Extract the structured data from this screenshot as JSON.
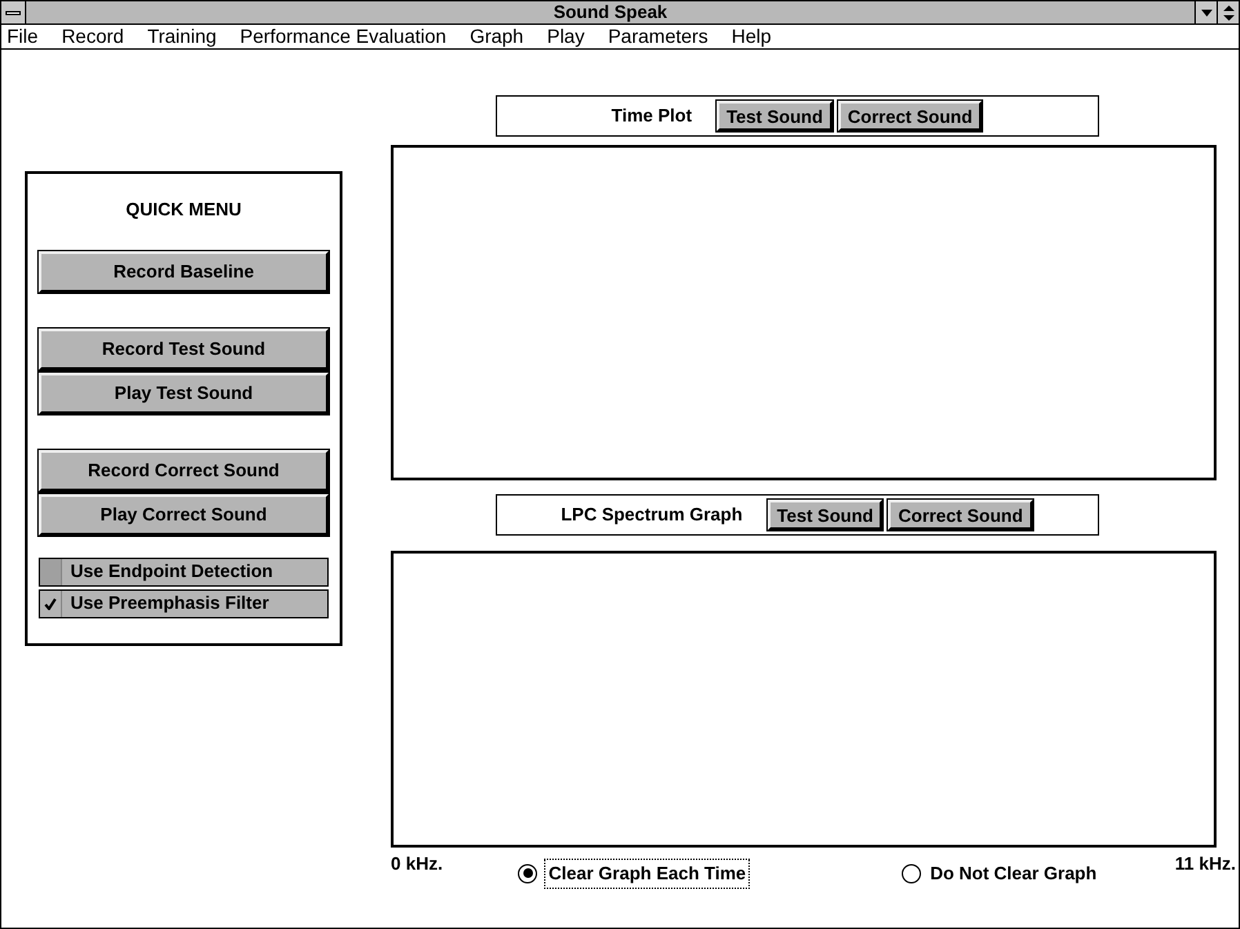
{
  "window": {
    "title": "Sound Speak"
  },
  "menu": [
    {
      "label": "File"
    },
    {
      "label": "Record"
    },
    {
      "label": "Training"
    },
    {
      "label": "Performance Evaluation"
    },
    {
      "label": "Graph"
    },
    {
      "label": "Play"
    },
    {
      "label": "Parameters"
    },
    {
      "label": "Help"
    }
  ],
  "quick_menu": {
    "title": "QUICK MENU",
    "groups": [
      [
        {
          "kind": "button",
          "label": "Record Baseline"
        }
      ],
      [
        {
          "kind": "button",
          "label": "Record Test Sound"
        },
        {
          "kind": "button",
          "label": "Play Test Sound"
        }
      ],
      [
        {
          "kind": "button",
          "label": "Record Correct Sound"
        },
        {
          "kind": "button",
          "label": "Play Correct Sound"
        }
      ],
      [
        {
          "kind": "checkbox",
          "label": "Use Endpoint Detection",
          "checked": false
        },
        {
          "kind": "checkbox",
          "label": "Use Preemphasis Filter",
          "checked": true
        }
      ]
    ]
  },
  "time_plot": {
    "title": "Time Plot",
    "buttons": [
      "Test Sound",
      "Correct Sound"
    ]
  },
  "lpc_spectrum": {
    "title": "LPC Spectrum Graph",
    "buttons": [
      "Test Sound",
      "Correct Sound"
    ],
    "x_min": "0 kHz.",
    "x_max": "11 kHz.",
    "options": [
      {
        "label": "Clear Graph Each Time",
        "selected": true
      },
      {
        "label": "Do Not Clear Graph",
        "selected": false
      }
    ]
  }
}
